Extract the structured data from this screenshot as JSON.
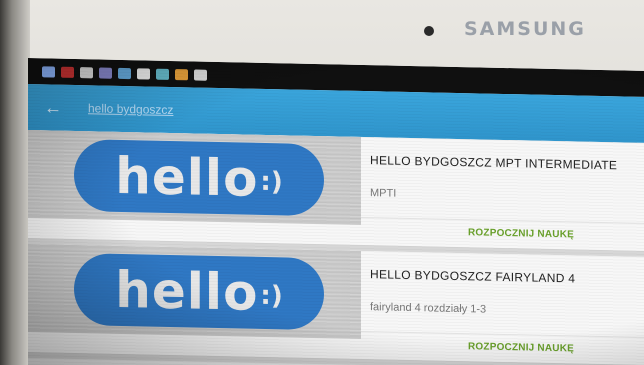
{
  "device": {
    "brand": "SAMSUNG",
    "status_icons": [
      {
        "name": "screen-mirror-icon",
        "color": "#8fb7ff"
      },
      {
        "name": "car-icon",
        "color": "#c33"
      },
      {
        "name": "media-icon",
        "color": "#ddd"
      },
      {
        "name": "image-icon",
        "color": "#88c"
      },
      {
        "name": "gallery-icon",
        "color": "#6ad"
      },
      {
        "name": "soccer-icon",
        "color": "#eee"
      },
      {
        "name": "photo-icon",
        "color": "#6bc"
      },
      {
        "name": "app-icon",
        "color": "#e9a23b"
      },
      {
        "name": "clipboard-icon",
        "color": "#ddd"
      }
    ]
  },
  "appbar": {
    "back_icon": "←",
    "title": "hello bydgoszcz"
  },
  "courses": [
    {
      "logo_text": "hello",
      "logo_smile": ":)",
      "title": "HELLO BYDGOSZCZ MPT INTERMEDIATE",
      "subtitle": "MPTI",
      "action": "ROZPOCZNIJ NAUKĘ"
    },
    {
      "logo_text": "hello",
      "logo_smile": ":)",
      "title": "HELLO BYDGOSZCZ FAIRYLAND 4",
      "subtitle": "fairyland 4 rozdziały 1-3",
      "action": "ROZPOCZNIJ NAUKĘ"
    }
  ],
  "colors": {
    "appbar": "#3aa5dc",
    "logo_blue": "#2f78c4",
    "action_green": "#6aa12c"
  }
}
